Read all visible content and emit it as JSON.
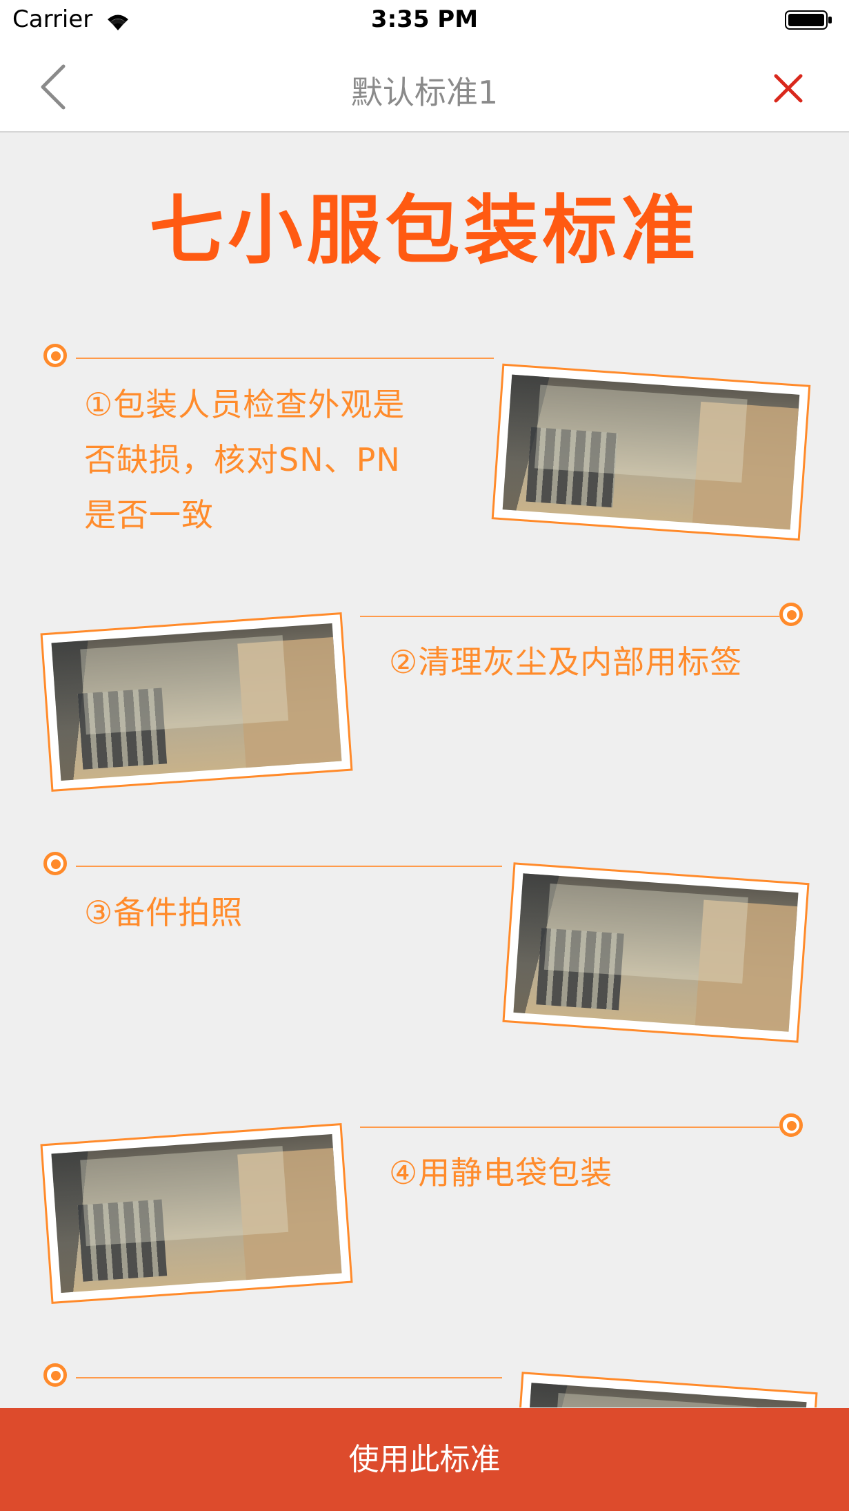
{
  "status_bar": {
    "carrier": "Carrier",
    "time": "3:35 PM"
  },
  "nav": {
    "title": "默认标准1"
  },
  "content": {
    "title": "七小服包装标准",
    "steps": [
      {
        "text_lines": [
          "①包装人员检查外观是",
          "否缺损，核对SN、PN",
          "是否一致"
        ]
      },
      {
        "text_lines": [
          "②清理灰尘及内部用标签"
        ]
      },
      {
        "text_lines": [
          "③备件拍照"
        ]
      },
      {
        "text_lines": [
          "④用静电袋包装"
        ]
      }
    ]
  },
  "bottom_button": {
    "label": "使用此标准"
  },
  "colors": {
    "accent": "#ff5a12",
    "step_text": "#ff8b2b",
    "button_bg": "#dd4b2c",
    "close_icon": "#d9281c"
  }
}
